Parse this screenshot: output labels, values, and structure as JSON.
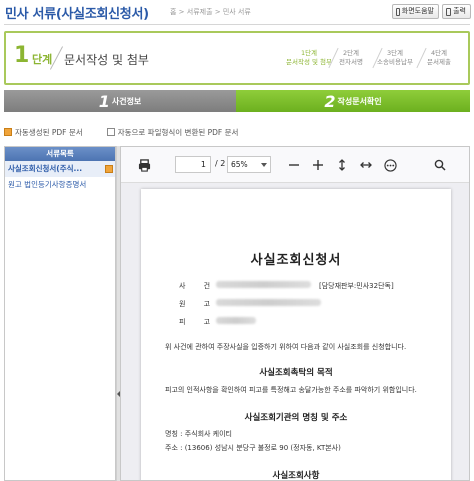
{
  "header": {
    "title": "민사 서류(사실조회신청서)",
    "breadcrumb": "홈 > 서류제출 > 민사 서류",
    "help_label": "화면도움말",
    "print_label": "출력"
  },
  "step_panel": {
    "step_number": "1",
    "step_word": "단계",
    "step_name": "문서작성 및 첨부",
    "steps": [
      {
        "line1": "1단계",
        "line2": "문서작성 및 첨부",
        "active": true
      },
      {
        "line1": "2단계",
        "line2": "전자서명",
        "active": false
      },
      {
        "line1": "3단계",
        "line2": "소송비용납부",
        "active": false
      },
      {
        "line1": "4단계",
        "line2": "문서제출",
        "active": false
      }
    ]
  },
  "tabs": [
    {
      "num": "1",
      "label": "사건정보"
    },
    {
      "num": "2",
      "label": "작성문서확인"
    }
  ],
  "legend": {
    "auto_pdf": "자동생성된 PDF 문서",
    "converted_pdf": "자동으로 파일형식이 변환된 PDF 문서"
  },
  "sidebar": {
    "header": "서류목록",
    "items": [
      {
        "label": "사실조회신청서(주식..."
      },
      {
        "label": "원고 법인등기사항증명서"
      }
    ]
  },
  "viewer": {
    "page_current": "1",
    "page_total": "/ 2",
    "zoom": "65%",
    "icons": {
      "print": "print-icon",
      "zoom_out": "minus-icon",
      "zoom_in": "plus-icon",
      "fit_height": "vertical-arrows-icon",
      "fit_width": "horizontal-arrows-icon",
      "more": "more-icon",
      "search": "search-icon"
    }
  },
  "document": {
    "title": "사실조회신청서",
    "case_label": "사 건",
    "case_assign": "[담당재판부:민사32단독]",
    "plaintiff_label": "원 고",
    "defendant_label": "피 고",
    "intro": "위 사건에 관하여 주장사실을 입증하기 위하여 다음과 같이 사실조회를 신청합니다.",
    "section1": "사실조회촉탁의 목적",
    "section1_text": "피고의 인적사항을 확인하여 피고를 특정해고 송달가능한 주소를 파악하기 위함입니다.",
    "section2": "사실조회기관의 명칭 및 주소",
    "org_name": "명칭 : 주식회사 케이티",
    "org_addr": "주소 : (13606) 성남시 분당구 불정로 90 (정자동, KT본사)",
    "section3": "사실조회사항"
  }
}
